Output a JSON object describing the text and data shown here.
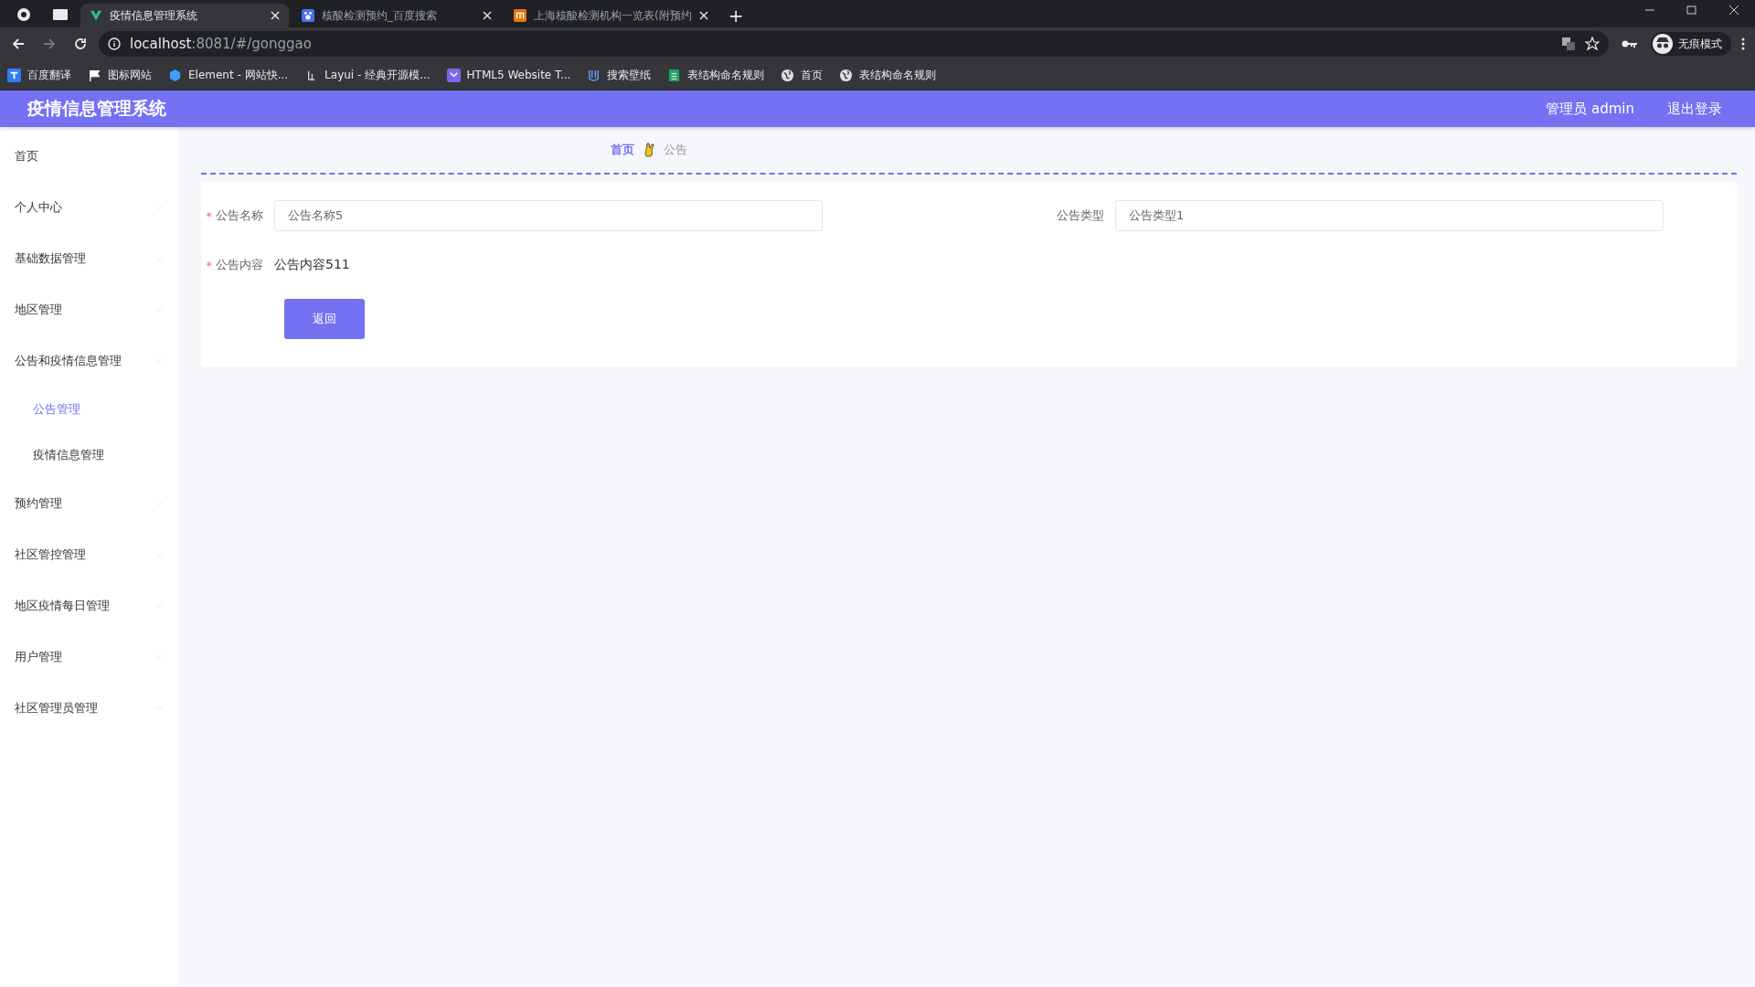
{
  "browser": {
    "tabs": [
      {
        "title": "疫情信息管理系统",
        "selected": true,
        "kind": "vue"
      },
      {
        "title": "核酸检测预约_百度搜索",
        "selected": false,
        "kind": "baidu"
      },
      {
        "title": "上海核酸检测机构一览表(附预约",
        "selected": false,
        "kind": "site"
      }
    ],
    "new_tab": "+",
    "address": {
      "host": "localhost",
      "path": ":8081/#/gonggao"
    },
    "profile": "无痕模式",
    "bookmarks": [
      {
        "label": "百度翻译",
        "kind": "translate"
      },
      {
        "label": "图标网站",
        "kind": "flag"
      },
      {
        "label": "Element - 网站快...",
        "kind": "hex"
      },
      {
        "label": "Layui - 经典开源模...",
        "kind": "layui"
      },
      {
        "label": "HTML5 Website T...",
        "kind": "html5"
      },
      {
        "label": "搜索壁纸",
        "kind": "wall"
      },
      {
        "label": "表结构命名规则",
        "kind": "sheet"
      },
      {
        "label": "首页",
        "kind": "globe"
      },
      {
        "label": "表结构命名规则",
        "kind": "globe"
      }
    ]
  },
  "app": {
    "title": "疫情信息管理系统",
    "user": "管理员 admin",
    "logout": "退出登录"
  },
  "sidebar": {
    "items": [
      {
        "label": "首页",
        "selected": false
      },
      {
        "label": "个人中心",
        "selected": false
      },
      {
        "label": "基础数据管理",
        "selected": false
      },
      {
        "label": "地区管理",
        "selected": false
      },
      {
        "label": "公告和疫情信息管理",
        "selected": false,
        "children": [
          {
            "label": "公告管理",
            "selected": true
          },
          {
            "label": "疫情信息管理",
            "selected": false
          }
        ]
      },
      {
        "label": "预约管理",
        "selected": false
      },
      {
        "label": "社区管控管理",
        "selected": false
      },
      {
        "label": "地区疫情每日管理",
        "selected": false
      },
      {
        "label": "用户管理",
        "selected": false
      },
      {
        "label": "社区管理员管理",
        "selected": false
      }
    ]
  },
  "breadcrumb": {
    "home": "首页",
    "current": "公告"
  },
  "form": {
    "fields": [
      {
        "label": "公告名称",
        "required_mark": "*",
        "kind": "input",
        "value": "公告名称5"
      },
      {
        "label": "公告类型",
        "kind": "input",
        "value": "公告类型1"
      },
      {
        "label": "公告内容",
        "required_mark": "*",
        "kind": "text",
        "value": "公告内容511"
      }
    ],
    "button": "返回"
  }
}
